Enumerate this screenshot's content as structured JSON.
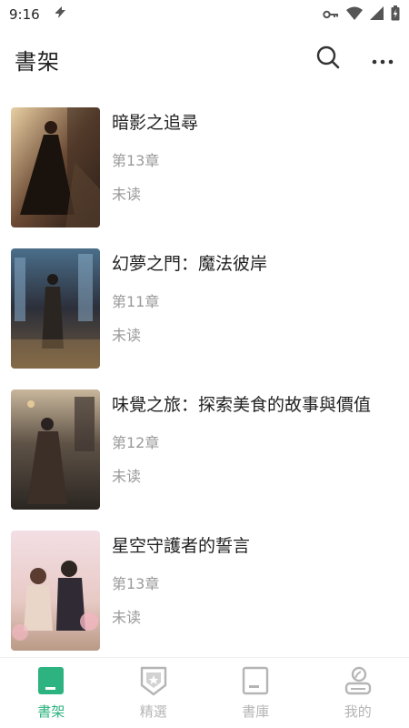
{
  "status_bar": {
    "time": "9:16",
    "icons": [
      "notification-icon",
      "key-icon",
      "wifi-icon",
      "signal-icon",
      "battery-icon"
    ]
  },
  "app_bar": {
    "title": "書架",
    "actions": [
      "search-icon",
      "more-icon"
    ]
  },
  "books": [
    {
      "title": "暗影之追尋",
      "chapter": "第13章",
      "status": "未读"
    },
    {
      "title": "幻夢之門：魔法彼岸",
      "chapter": "第11章",
      "status": "未读"
    },
    {
      "title": "味覺之旅：探索美食的故事與價值",
      "chapter": "第12章",
      "status": "未读"
    },
    {
      "title": "星空守護者的誓言",
      "chapter": "第13章",
      "status": "未读"
    }
  ],
  "bottom_nav": {
    "items": [
      {
        "label": "書架",
        "icon": "bookshelf-icon",
        "active": true
      },
      {
        "label": "精選",
        "icon": "badge-icon",
        "active": false
      },
      {
        "label": "書庫",
        "icon": "library-icon",
        "active": false
      },
      {
        "label": "我的",
        "icon": "profile-icon",
        "active": false
      }
    ]
  },
  "colors": {
    "accent": "#2db37f",
    "inactive": "#b5b5b5",
    "secondary_text": "#9a9a9a"
  }
}
